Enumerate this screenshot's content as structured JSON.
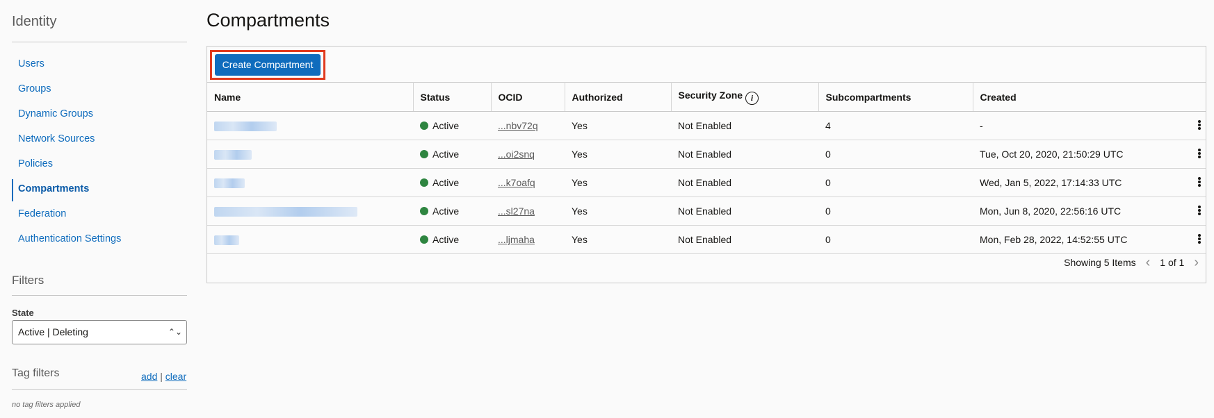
{
  "sidebar": {
    "title": "Identity",
    "items": [
      {
        "label": "Users"
      },
      {
        "label": "Groups"
      },
      {
        "label": "Dynamic Groups"
      },
      {
        "label": "Network Sources"
      },
      {
        "label": "Policies"
      },
      {
        "label": "Compartments",
        "active": true
      },
      {
        "label": "Federation"
      },
      {
        "label": "Authentication Settings"
      }
    ],
    "filters_title": "Filters",
    "state_label": "State",
    "state_value": "Active | Deleting",
    "tag_filters_title": "Tag filters",
    "tag_add": "add",
    "tag_sep": "|",
    "tag_clear": "clear",
    "tag_empty": "no tag filters applied"
  },
  "main": {
    "title": "Compartments",
    "create_button": "Create Compartment",
    "columns": [
      "Name",
      "Status",
      "OCID",
      "Authorized",
      "Security Zone",
      "Subcompartments",
      "Created"
    ],
    "rows": [
      {
        "status": "Active",
        "ocid": "...nbv72q",
        "authorized": "Yes",
        "security_zone": "Not Enabled",
        "subcompartments": "4",
        "created": "-"
      },
      {
        "status": "Active",
        "ocid": "...oi2snq",
        "authorized": "Yes",
        "security_zone": "Not Enabled",
        "subcompartments": "0",
        "created": "Tue, Oct 20, 2020, 21:50:29 UTC"
      },
      {
        "status": "Active",
        "ocid": "...k7oafq",
        "authorized": "Yes",
        "security_zone": "Not Enabled",
        "subcompartments": "0",
        "created": "Wed, Jan 5, 2022, 17:14:33 UTC"
      },
      {
        "status": "Active",
        "ocid": "...sl27na",
        "authorized": "Yes",
        "security_zone": "Not Enabled",
        "subcompartments": "0",
        "created": "Mon, Jun 8, 2020, 22:56:16 UTC"
      },
      {
        "status": "Active",
        "ocid": "...ljmaha",
        "authorized": "Yes",
        "security_zone": "Not Enabled",
        "subcompartments": "0",
        "created": "Mon, Feb 28, 2022, 14:52:55 UTC"
      }
    ],
    "showing": "Showing 5 Items",
    "page": "1 of 1",
    "colors": {
      "accent": "#0f6cbd",
      "active_status": "#2e8540",
      "highlight": "#e03a1e"
    }
  }
}
